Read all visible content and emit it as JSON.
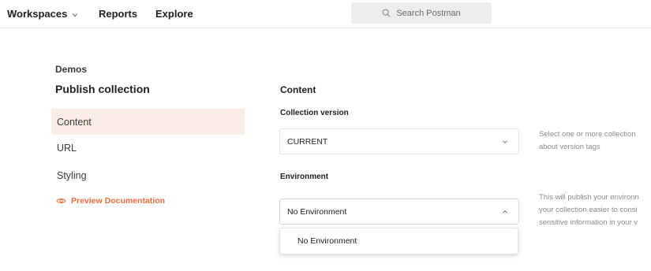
{
  "topbar": {
    "workspaces_label": "Workspaces",
    "reports_label": "Reports",
    "explore_label": "Explore",
    "search_placeholder": "Search Postman"
  },
  "breadcrumb": "Demos",
  "page_title": "Publish collection",
  "sidebar": {
    "items": [
      {
        "label": "Content",
        "active": true
      },
      {
        "label": "URL",
        "active": false
      },
      {
        "label": "Styling",
        "active": false
      }
    ],
    "preview_label": "Preview Documentation"
  },
  "main": {
    "section_title": "Content",
    "version": {
      "label": "Collection version",
      "value": "CURRENT",
      "help": [
        "Select one or more collection",
        "about version tags"
      ]
    },
    "environment": {
      "label": "Environment",
      "value": "No Environment",
      "options": [
        "No Environment"
      ],
      "help": [
        "This will publish your environn",
        "your collection easier to consi",
        "sensitive information in your v"
      ]
    }
  },
  "colors": {
    "accent": "#f26b3a",
    "active_bg": "#fbede6",
    "search_bg": "#ededed",
    "muted_text": "#8a8a8a"
  },
  "icons": {
    "workspaces_dropdown": "chevron-down-icon",
    "search": "search-icon",
    "preview": "eye-icon",
    "version_select": "chevron-down-icon",
    "env_select": "chevron-up-icon"
  }
}
